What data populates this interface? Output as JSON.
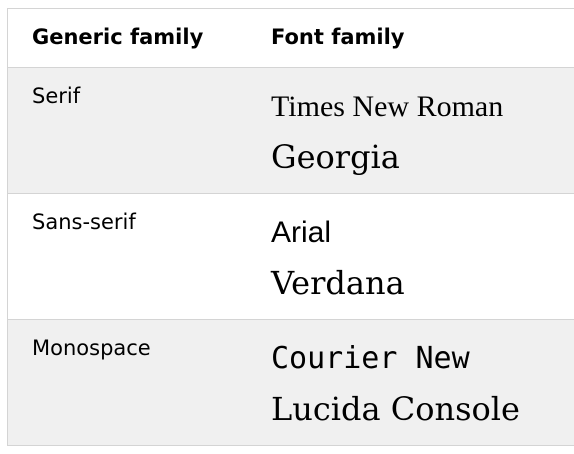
{
  "table": {
    "headers": {
      "generic": "Generic family",
      "font": "Font family"
    },
    "rows": [
      {
        "generic": "Serif",
        "fonts": [
          "Times New Roman",
          "Georgia"
        ]
      },
      {
        "generic": "Sans-serif",
        "fonts": [
          "Arial",
          "Verdana"
        ]
      },
      {
        "generic": "Monospace",
        "fonts": [
          "Courier New",
          "Lucida Console"
        ]
      }
    ]
  },
  "colors": {
    "shaded_row": "#f0f0f0",
    "border": "#d4d4d4",
    "text": "#000000"
  }
}
